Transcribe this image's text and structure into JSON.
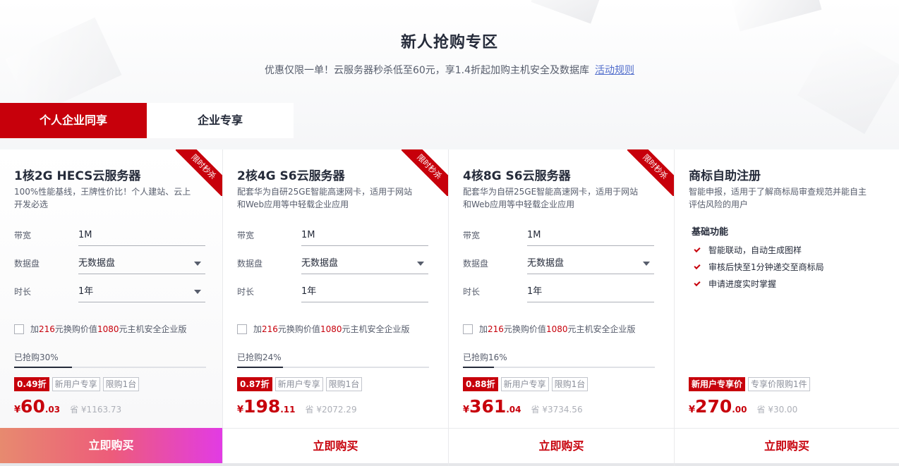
{
  "header": {
    "title": "新人抢购专区",
    "subtitle": "优惠仅限一单！云服务器秒杀低至60元，享1.4折起加购主机安全及数据库",
    "rules_link": "活动规则"
  },
  "tabs": [
    {
      "label": "个人企业同享",
      "active": true
    },
    {
      "label": "企业专享",
      "active": false
    }
  ],
  "labels": {
    "bandwidth": "带宽",
    "disk": "数据盘",
    "duration": "时长",
    "buy": "立即购买"
  },
  "cards": [
    {
      "ribbon": "限时秒杀",
      "title": "1核2G HECS云服务器",
      "desc": "100%性能基线，王牌性价比！个人建站、云上开发必选",
      "bandwidth": "1M",
      "disk": "无数据盘",
      "duration": "1年",
      "duration_dropdown": true,
      "addon_pre": "加",
      "addon_price": "216",
      "addon_mid": "元换购价值",
      "addon_value": "1080",
      "addon_post": "元主机安全企业版",
      "progress_text": "已抢购30%",
      "progress": 0.3,
      "discount": "0.49折",
      "tag1": "新用户专享",
      "tag2": "限购1台",
      "currency": "¥",
      "price_int": "60",
      "price_dec": ".03",
      "save": "省 ¥1163.73",
      "buy_highlight": true
    },
    {
      "ribbon": "限时秒杀",
      "title": "2核4G S6云服务器",
      "desc": "配套华为自研25GE智能高速网卡，适用于网站和Web应用等中轻载企业应用",
      "bandwidth": "1M",
      "disk": "无数据盘",
      "duration": "1年",
      "duration_dropdown": false,
      "addon_pre": "加",
      "addon_price": "216",
      "addon_mid": "元换购价值",
      "addon_value": "1080",
      "addon_post": "元主机安全企业版",
      "progress_text": "已抢购24%",
      "progress": 0.24,
      "discount": "0.87折",
      "tag1": "新用户专享",
      "tag2": "限购1台",
      "currency": "¥",
      "price_int": "198",
      "price_dec": ".11",
      "save": "省 ¥2072.29",
      "buy_highlight": false
    },
    {
      "ribbon": "限时秒杀",
      "title": "4核8G S6云服务器",
      "desc": "配套华为自研25GE智能高速网卡，适用于网站和Web应用等中轻载企业应用",
      "bandwidth": "1M",
      "disk": "无数据盘",
      "duration": "1年",
      "duration_dropdown": false,
      "addon_pre": "加",
      "addon_price": "216",
      "addon_mid": "元换购价值",
      "addon_value": "1080",
      "addon_post": "元主机安全企业版",
      "progress_text": "已抢购16%",
      "progress": 0.16,
      "discount": "0.88折",
      "tag1": "新用户专享",
      "tag2": "限购1台",
      "currency": "¥",
      "price_int": "361",
      "price_dec": ".04",
      "save": "省 ¥3734.56",
      "buy_highlight": false
    }
  ],
  "trademark": {
    "title": "商标自助注册",
    "desc": "智能申报，适用于了解商标局审查规范并能自主评估风险的用户",
    "features_title": "基础功能",
    "features": [
      "智能联动，自动生成图样",
      "审核后快至1分钟递交至商标局",
      "申请进度实时掌握"
    ],
    "tag1": "新用户专享价",
    "tag2": "专享价限购1件",
    "currency": "¥",
    "price_int": "270",
    "price_dec": ".00",
    "save": "省 ¥30.00"
  },
  "colors": {
    "brand_red": "#c7000b",
    "buy_gradient_start": "#e78a6f",
    "buy_gradient_end": "#e23be4"
  }
}
